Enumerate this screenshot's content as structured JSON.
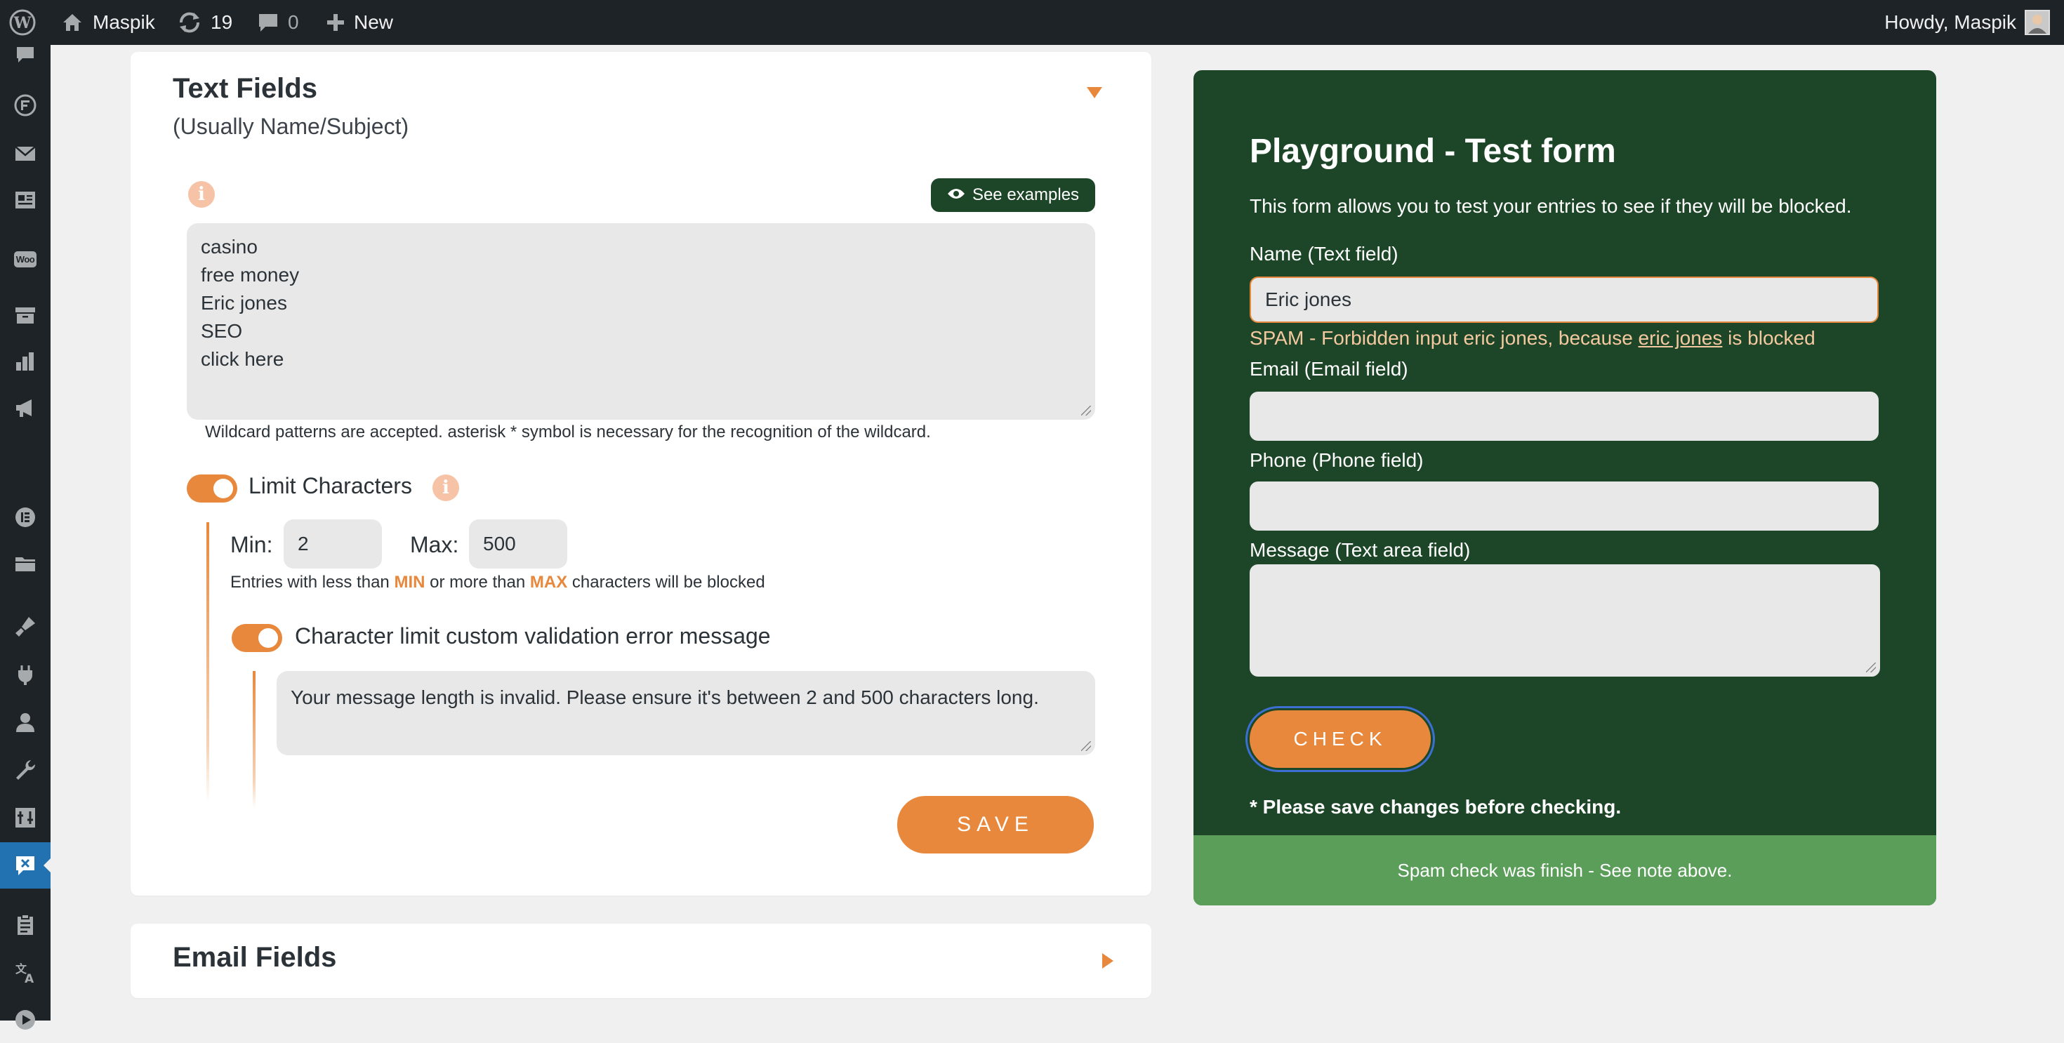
{
  "adminbar": {
    "site_name": "Maspik",
    "updates_count": "19",
    "comments_count": "0",
    "new_label": "New",
    "howdy": "Howdy, Maspik"
  },
  "sidemenu": {
    "icons": [
      "comments-icon",
      "forms-icon",
      "mail-icon",
      "pages-icon",
      "woocommerce-icon",
      "archive-icon",
      "analytics-icon",
      "marketing-icon",
      "elementor-icon",
      "folder-icon",
      "appearance-icon",
      "plugins-icon",
      "users-icon",
      "tools-icon",
      "settings-icon",
      "maspik-icon",
      "clipboard-icon",
      "translate-icon",
      "play-icon"
    ],
    "woo_label": "Woo"
  },
  "text_fields": {
    "title": "Text Fields",
    "subtitle": "(Usually Name/Subject)",
    "see_examples": "See examples",
    "blocked_entries": [
      "casino",
      "free money",
      "Eric jones",
      "SEO",
      "click here"
    ],
    "wildcard_note": "Wildcard patterns are accepted. asterisk * symbol is necessary for the recognition of the wildcard.",
    "limit_label": "Limit Characters",
    "limit_enabled": true,
    "min_label": "Min:",
    "min_value": "2",
    "max_label": "Max:",
    "max_value": "500",
    "limit_note_1": "Entries with less than",
    "limit_note_min": "MIN",
    "limit_note_2": "or more than",
    "limit_note_max": "MAX",
    "limit_note_3": "characters will be blocked",
    "custom_msg_label": "Character limit custom validation error message",
    "custom_msg_enabled": true,
    "custom_msg_value": "Your message length is invalid. Please ensure it's between 2 and 500 characters long.",
    "save_label": "SAVE"
  },
  "email_fields": {
    "title": "Email Fields"
  },
  "playground": {
    "title": "Playground - Test form",
    "description": "This form allows you to test your entries to see if they will be blocked.",
    "name_label": "Name (Text field)",
    "name_value": "Eric jones",
    "spam_prefix": "SPAM - Forbidden input eric jones, because ",
    "spam_term": "eric jones",
    "spam_suffix": " is blocked",
    "email_label": "Email (Email field)",
    "email_value": "",
    "phone_label": "Phone (Phone field)",
    "phone_value": "",
    "message_label": "Message (Text area field)",
    "message_value": "",
    "check_label": "CHECK",
    "save_note": "* Please save changes before checking.",
    "result_note": "Spam check was finish - See note above."
  },
  "colors": {
    "accent": "#e8883c",
    "playground_bg": "#1c4627",
    "result_bg": "#5b9e5a",
    "adminbar_bg": "#1d2327",
    "spam_text": "#f5c9a0"
  }
}
